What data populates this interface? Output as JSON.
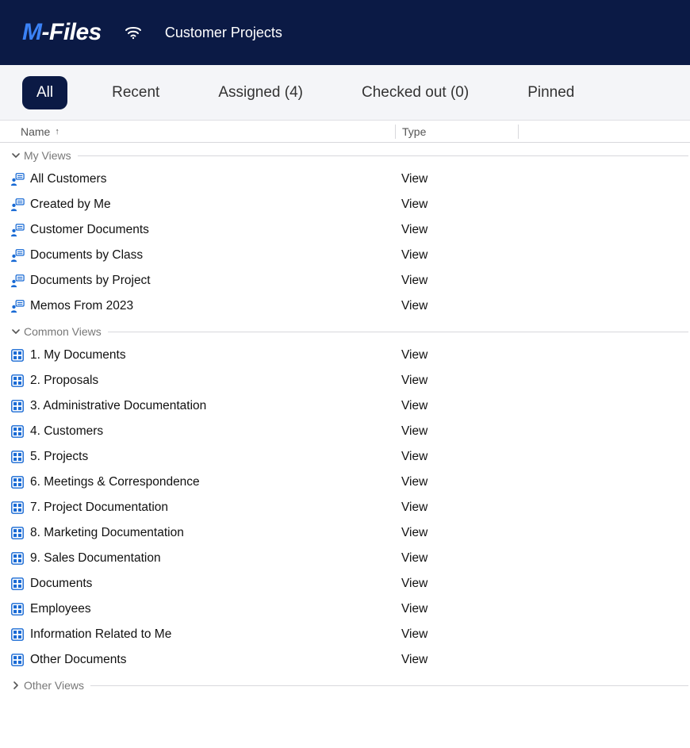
{
  "header": {
    "logo_m": "M",
    "logo_rest": "-Files",
    "vault_name": "Customer Projects"
  },
  "tabs": [
    {
      "label": "All",
      "active": true
    },
    {
      "label": "Recent",
      "active": false
    },
    {
      "label": "Assigned (4)",
      "active": false
    },
    {
      "label": "Checked out (0)",
      "active": false
    },
    {
      "label": "Pinned",
      "active": false
    }
  ],
  "columns": {
    "name": "Name",
    "type": "Type"
  },
  "groups": [
    {
      "label": "My Views",
      "expanded": true,
      "icon": "person-view",
      "items": [
        {
          "name": "All Customers",
          "type": "View"
        },
        {
          "name": "Created by Me",
          "type": "View"
        },
        {
          "name": "Customer Documents",
          "type": "View"
        },
        {
          "name": "Documents by Class",
          "type": "View"
        },
        {
          "name": "Documents by Project",
          "type": "View"
        },
        {
          "name": "Memos From 2023",
          "type": "View"
        }
      ]
    },
    {
      "label": "Common Views",
      "expanded": true,
      "icon": "grid-view",
      "items": [
        {
          "name": "1. My Documents",
          "type": "View"
        },
        {
          "name": "2. Proposals",
          "type": "View"
        },
        {
          "name": "3. Administrative Documentation",
          "type": "View"
        },
        {
          "name": "4. Customers",
          "type": "View"
        },
        {
          "name": "5. Projects",
          "type": "View"
        },
        {
          "name": "6. Meetings & Correspondence",
          "type": "View"
        },
        {
          "name": "7. Project Documentation",
          "type": "View"
        },
        {
          "name": "8. Marketing Documentation",
          "type": "View"
        },
        {
          "name": "9. Sales Documentation",
          "type": "View"
        },
        {
          "name": "Documents",
          "type": "View"
        },
        {
          "name": "Employees",
          "type": "View"
        },
        {
          "name": "Information Related to Me",
          "type": "View"
        },
        {
          "name": "Other Documents",
          "type": "View"
        }
      ]
    },
    {
      "label": "Other Views",
      "expanded": false,
      "icon": "grid-view",
      "items": []
    }
  ]
}
